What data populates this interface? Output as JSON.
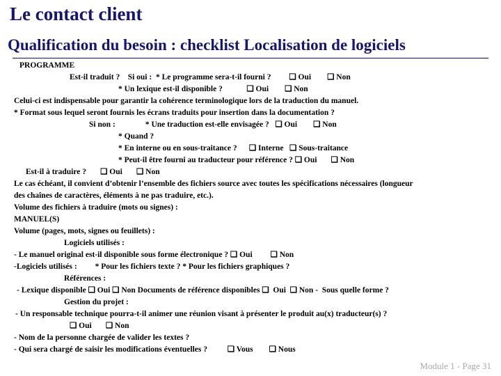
{
  "slide": {
    "title": "Le contact client",
    "subtitle": "Qualification du besoin : checklist Localisation de logiciels",
    "accent_color": "#16166e",
    "body_color": "#000000",
    "background_color": "#ffffff",
    "footer": "Module 1 - Page 31",
    "footer_color": "#a8a8a8",
    "checkbox_glyph": "❑"
  },
  "lines": [
    {
      "indent": 28,
      "text": "PROGRAMME"
    },
    {
      "indent": 100,
      "text": "Est-il traduit ?    Si oui :  * Le programme sera-t-il fourni ?         ❑ Oui        ❑ Non"
    },
    {
      "indent": 170,
      "text": "* Un lexique est-il disponible ?            ❑ Oui        ❑ Non"
    },
    {
      "indent": 20,
      "text": "Celui-ci est indispensable pour garantir la cohérence terminologique lors de la traduction du manuel."
    },
    {
      "indent": 20,
      "text": "* Format sous lequel seront fournis les écrans traduits pour insertion dans la documentation ?"
    },
    {
      "indent": 128,
      "text": "Si non :               * Une traduction est-elle envisagée ?   ❑ Oui        ❑ Non"
    },
    {
      "indent": 170,
      "text": "* Quand ?"
    },
    {
      "indent": 170,
      "text": "* En interne ou en sous-traitance ?      ❑ Interne   ❑ Sous-traitance"
    },
    {
      "indent": 170,
      "text": "* Peut-il être fourni au traducteur pour référence ? ❑ Oui       ❑ Non"
    },
    {
      "indent": 37,
      "text": "Est-il à traduire ?       ❑ Oui       ❑ Non"
    },
    {
      "indent": 20,
      "text": "Le cas échéant, il convient d’obtenir l’ensemble des fichiers source avec toutes les spécifications nécessaires (longueur"
    },
    {
      "indent": 20,
      "text": "des chaînes de caractères, éléments à ne pas traduire, etc.)."
    },
    {
      "indent": 20,
      "text": "Volume des fichiers à traduire (mots ou signes) :"
    },
    {
      "indent": 20,
      "text": "MANUEL(S)"
    },
    {
      "indent": 20,
      "text": "Volume (pages, mots, signes ou feuillets) :"
    },
    {
      "indent": 92,
      "text": "Logiciels utilisés :"
    },
    {
      "indent": 20,
      "text": "- Le manuel original est-il disponible sous forme électronique ? ❑ Oui         ❑ Non"
    },
    {
      "indent": 20,
      "text": "-Logiciels utilisés :         * Pour les fichiers texte ? * Pour les fichiers graphiques ?"
    },
    {
      "indent": 92,
      "text": "Références :"
    },
    {
      "indent": 24,
      "text": "- Lexique disponible ❑ Oui ❑ Non Documents de référence disponibles ❑  Oui  ❑ Non -  Sous quelle forme ?"
    },
    {
      "indent": 92,
      "text": "Gestion du projet :"
    },
    {
      "indent": 22,
      "text": "- Un responsable technique pourra-t-il animer une réunion visant à présenter le produit au(x) traducteur(s) ?"
    },
    {
      "indent": 100,
      "text": "❑ Oui       ❑ Non"
    },
    {
      "indent": 20,
      "text": "- Nom de la personne chargée de valider les textes ?"
    },
    {
      "indent": 20,
      "text": "- Qui sera chargé de saisir les modifications éventuelles ?          ❑ Vous        ❑ Nous"
    }
  ]
}
